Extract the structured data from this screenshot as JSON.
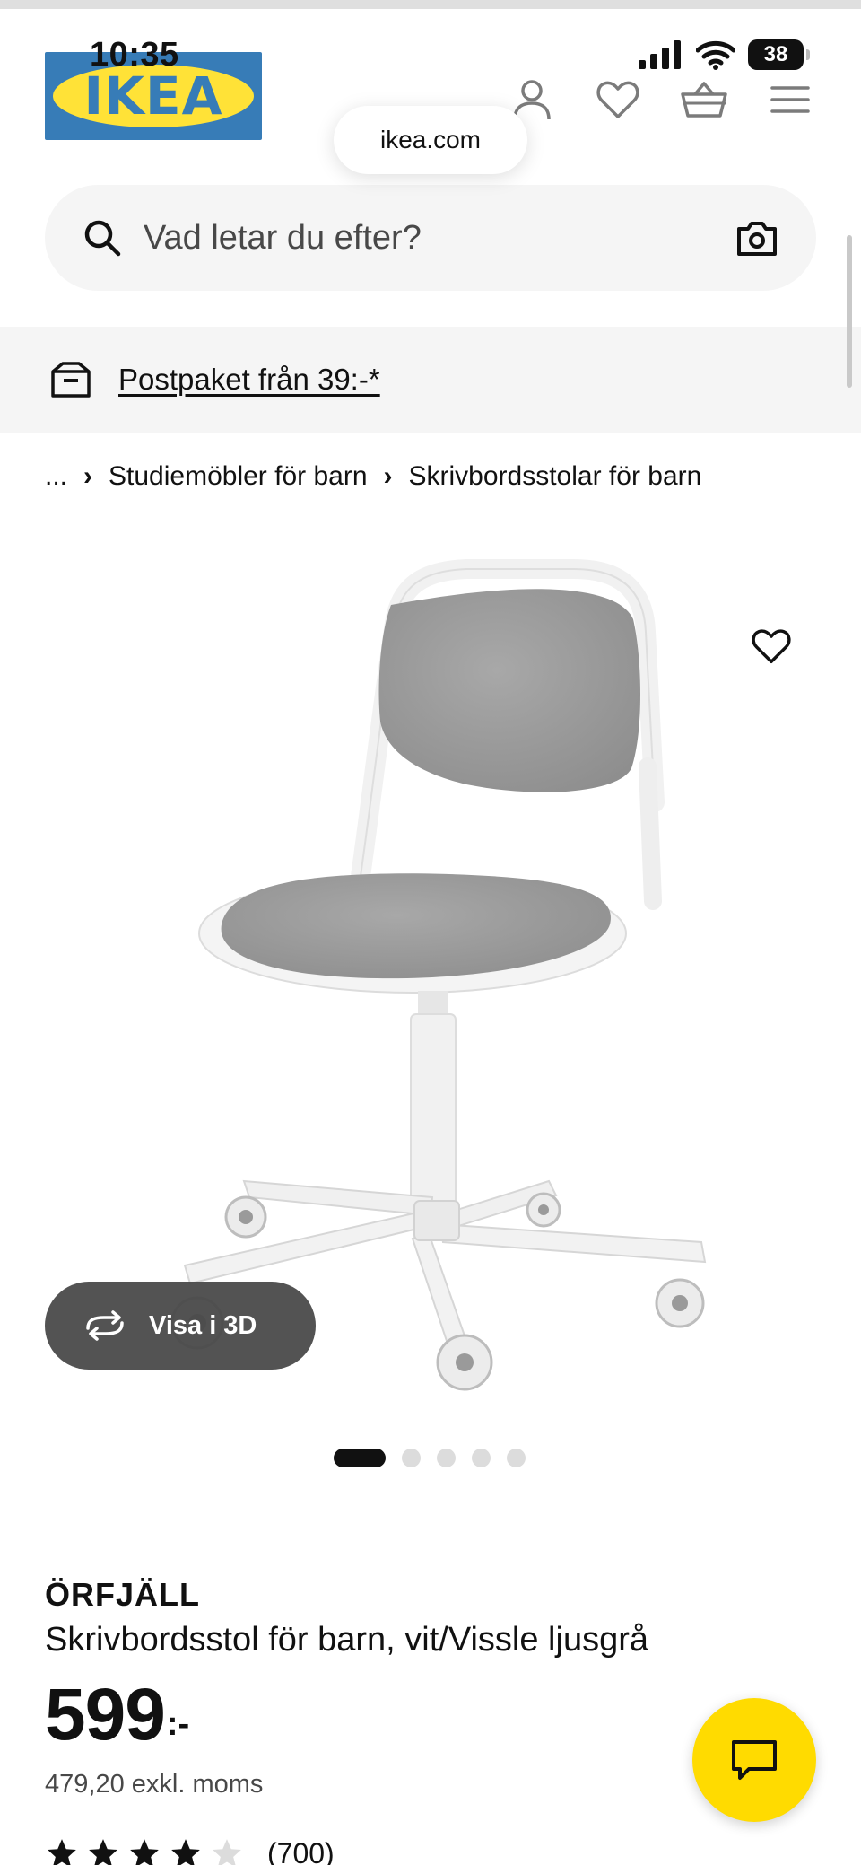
{
  "status_bar": {
    "time": "10:35",
    "battery": "38"
  },
  "header": {
    "logo_text": "IKEA",
    "url": "ikea.com",
    "icons": [
      "user-icon",
      "heart-icon",
      "basket-icon",
      "menu-icon"
    ]
  },
  "search": {
    "placeholder": "Vad letar du efter?"
  },
  "banner": {
    "text": "Postpaket från 39:-*"
  },
  "breadcrumb": {
    "ellipsis": "...",
    "items": [
      "Studiemöbler för barn",
      "Skrivbordsstolar för barn"
    ]
  },
  "gallery": {
    "view_3d_label": "Visa i 3D",
    "image_count": 5,
    "active_index": 0
  },
  "product": {
    "name": "ÖRFJÄLL",
    "description": "Skrivbordsstol för barn, vit/Vissle ljusgrå",
    "price_integer": "599",
    "price_suffix": ":-",
    "price_excl_vat": "479,20 exkl. moms",
    "rating_value": 4,
    "rating_count": "(700)"
  },
  "colors": {
    "ikea_blue": "#0058a3",
    "ikea_yellow": "#ffdb00",
    "text": "#111111"
  }
}
